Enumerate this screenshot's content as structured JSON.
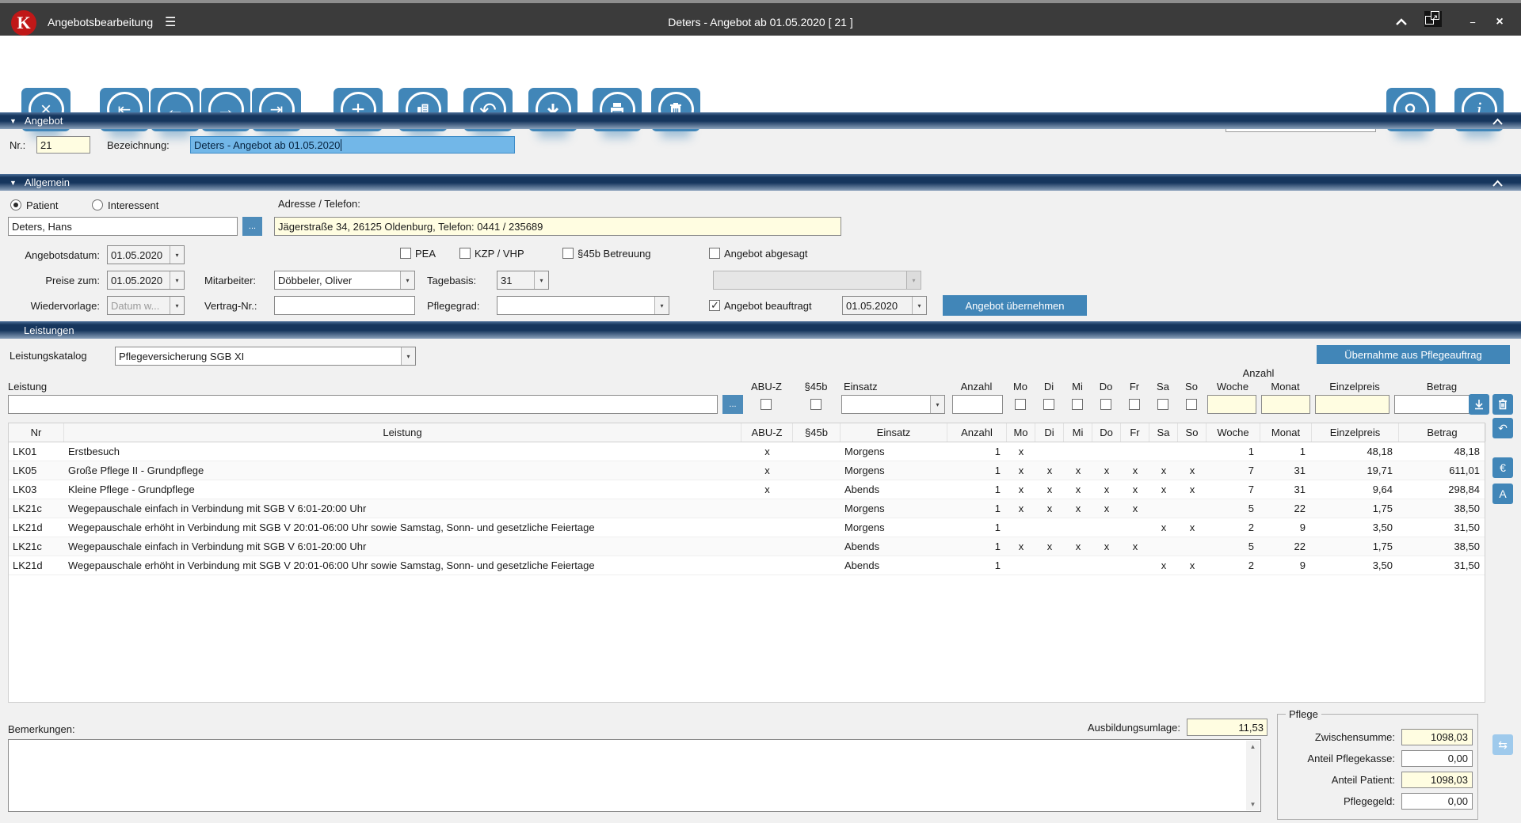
{
  "titlebar": {
    "app_title": "Angebotsbearbeitung",
    "doc_title": "Deters - Angebot ab 01.05.2020  [ 21 ]"
  },
  "icons": {
    "logo_letter": "K",
    "menu": "☰",
    "chevron_up": "∧",
    "minimize": "−",
    "close": "×",
    "close_record": "×",
    "first": "⇤",
    "prev": "←",
    "next": "→",
    "last": "⇥",
    "add": "+",
    "undo": "↶",
    "dropdown": "▾",
    "section_triangle": "▼",
    "euro": "€",
    "font": "A",
    "swap": "⇆",
    "scroll_up": "▲",
    "scroll_down": "▼",
    "dots": "..."
  },
  "toolbar": {
    "search_value": ""
  },
  "angebot": {
    "header": "Angebot",
    "nr_label": "Nr.:",
    "nr_value": "21",
    "bezeichnung_label": "Bezeichnung:",
    "bezeichnung_value": "Deters - Angebot ab 01.05.2020"
  },
  "allgemein": {
    "header": "Allgemein",
    "patient_label": "Patient",
    "interessent_label": "Interessent",
    "name_value": "Deters, Hans",
    "adresse_label": "Adresse / Telefon:",
    "adresse_value": "Jägerstraße 34, 26125 Oldenburg, Telefon: 0441 / 235689",
    "angebotsdatum_label": "Angebotsdatum:",
    "angebotsdatum_value": "01.05.2020",
    "pea_label": "PEA",
    "kzp_label": "KZP / VHP",
    "s45b_label": "§45b Betreuung",
    "abgesagt_label": "Angebot abgesagt",
    "preise_label": "Preise zum:",
    "preise_value": "01.05.2020",
    "mitarbeiter_label": "Mitarbeiter:",
    "mitarbeiter_value": "Döbbeler, Oliver",
    "tagebasis_label": "Tagebasis:",
    "tagebasis_value": "31",
    "wiedervorlage_label": "Wiedervorlage:",
    "wiedervorlage_value": "Datum w...",
    "vertrag_label": "Vertrag-Nr.:",
    "vertrag_value": "",
    "pflegegrad_label": "Pflegegrad:",
    "pflegegrad_value": "",
    "beauftragt_label": "Angebot beauftragt",
    "beauftragt_date": "01.05.2020",
    "uebernehmen_button": "Angebot übernehmen"
  },
  "leistungen": {
    "header": "Leistungen",
    "katalog_label": "Leistungskatalog",
    "katalog_value": "Pflegeversicherung SGB XI",
    "uebernahme_button": "Übernahme aus Pflegeauftrag",
    "anzahl_group_label": "Anzahl",
    "filter_labels": {
      "leistung": "Leistung",
      "abuz": "ABU-Z",
      "s45b": "§45b",
      "einsatz": "Einsatz",
      "anzahl": "Anzahl",
      "days": [
        "Mo",
        "Di",
        "Mi",
        "Do",
        "Fr",
        "Sa",
        "So"
      ],
      "woche": "Woche",
      "monat": "Monat",
      "einzelpreis": "Einzelpreis",
      "betrag": "Betrag"
    }
  },
  "table": {
    "columns": [
      "Nr",
      "Leistung",
      "ABU-Z",
      "§45b",
      "Einsatz",
      "Anzahl",
      "Mo",
      "Di",
      "Mi",
      "Do",
      "Fr",
      "Sa",
      "So",
      "Woche",
      "Monat",
      "Einzelpreis",
      "Betrag"
    ],
    "rows": [
      {
        "nr": "LK01",
        "leistung": "Erstbesuch",
        "abuz": "x",
        "s45b": "",
        "einsatz": "Morgens",
        "anzahl": "1",
        "days": [
          "x",
          "",
          "",
          "",
          "",
          "",
          ""
        ],
        "woche": "1",
        "monat": "1",
        "einzelpreis": "48,18",
        "betrag": "48,18"
      },
      {
        "nr": "LK05",
        "leistung": "Große Pflege II - Grundpflege",
        "abuz": "x",
        "s45b": "",
        "einsatz": "Morgens",
        "anzahl": "1",
        "days": [
          "x",
          "x",
          "x",
          "x",
          "x",
          "x",
          "x"
        ],
        "woche": "7",
        "monat": "31",
        "einzelpreis": "19,71",
        "betrag": "611,01"
      },
      {
        "nr": "LK03",
        "leistung": "Kleine Pflege - Grundpflege",
        "abuz": "x",
        "s45b": "",
        "einsatz": "Abends",
        "anzahl": "1",
        "days": [
          "x",
          "x",
          "x",
          "x",
          "x",
          "x",
          "x"
        ],
        "woche": "7",
        "monat": "31",
        "einzelpreis": "9,64",
        "betrag": "298,84"
      },
      {
        "nr": "LK21c",
        "leistung": "Wegepauschale einfach in Verbindung mit SGB V 6:01-20:00 Uhr",
        "abuz": "",
        "s45b": "",
        "einsatz": "Morgens",
        "anzahl": "1",
        "days": [
          "x",
          "x",
          "x",
          "x",
          "x",
          "",
          ""
        ],
        "woche": "5",
        "monat": "22",
        "einzelpreis": "1,75",
        "betrag": "38,50"
      },
      {
        "nr": "LK21d",
        "leistung": "Wegepauschale erhöht in Verbindung mit SGB V 20:01-06:00 Uhr sowie Samstag, Sonn- und gesetzliche Feiertage",
        "abuz": "",
        "s45b": "",
        "einsatz": "Morgens",
        "anzahl": "1",
        "days": [
          "",
          "",
          "",
          "",
          "",
          "x",
          "x"
        ],
        "woche": "2",
        "monat": "9",
        "einzelpreis": "3,50",
        "betrag": "31,50"
      },
      {
        "nr": "LK21c",
        "leistung": "Wegepauschale einfach in Verbindung mit SGB V 6:01-20:00 Uhr",
        "abuz": "",
        "s45b": "",
        "einsatz": "Abends",
        "anzahl": "1",
        "days": [
          "x",
          "x",
          "x",
          "x",
          "x",
          "",
          ""
        ],
        "woche": "5",
        "monat": "22",
        "einzelpreis": "1,75",
        "betrag": "38,50"
      },
      {
        "nr": "LK21d",
        "leistung": "Wegepauschale erhöht in Verbindung mit SGB V 20:01-06:00 Uhr sowie Samstag, Sonn- und gesetzliche Feiertage",
        "abuz": "",
        "s45b": "",
        "einsatz": "Abends",
        "anzahl": "1",
        "days": [
          "",
          "",
          "",
          "",
          "",
          "x",
          "x"
        ],
        "woche": "2",
        "monat": "9",
        "einzelpreis": "3,50",
        "betrag": "31,50"
      }
    ]
  },
  "footer": {
    "bemerkungen_label": "Bemerkungen:",
    "bemerkungen_value": "",
    "ausbildungsumlage_label": "Ausbildungsumlage:",
    "ausbildungsumlage_value": "11,53",
    "pflege": {
      "legend": "Pflege",
      "rows": [
        {
          "label": "Zwischensumme:",
          "value": "1098,03",
          "highlight": true
        },
        {
          "label": "Anteil Pflegekasse:",
          "value": "0,00",
          "highlight": false
        },
        {
          "label": "Anteil Patient:",
          "value": "1098,03",
          "highlight": true
        },
        {
          "label": "Pflegegeld:",
          "value": "0,00",
          "highlight": false
        }
      ]
    }
  },
  "colors": {
    "accent": "#4186b8",
    "header_gradient_dark": "#16365d",
    "input_yellow": "#fffde1",
    "titlebar": "#3b3b3b",
    "logo_red": "#c01818"
  }
}
